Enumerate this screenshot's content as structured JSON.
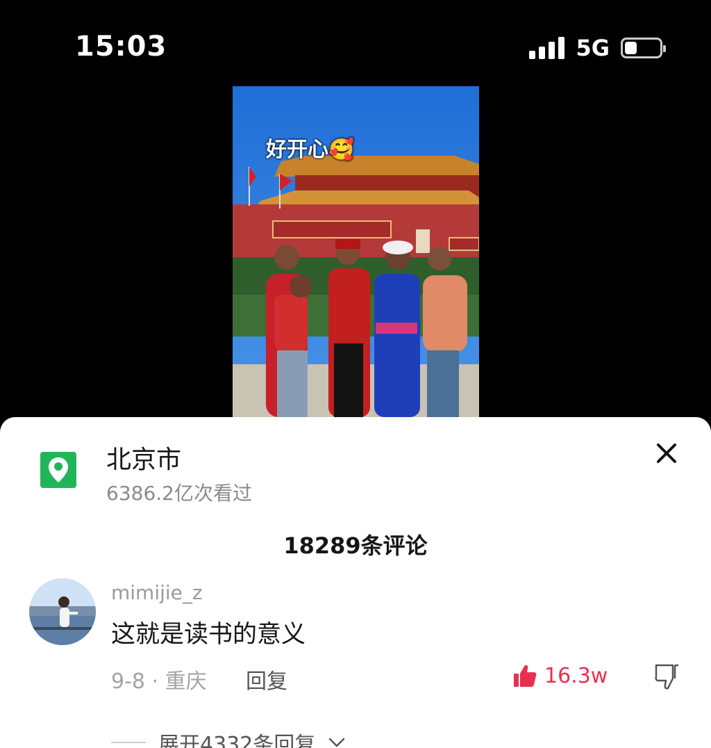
{
  "status_bar": {
    "time": "15:03",
    "network": "5G",
    "battery_level": 0.35
  },
  "video": {
    "caption": "好开心",
    "caption_emoji": "🥰"
  },
  "location": {
    "icon": "location-pin-icon",
    "title": "北京市",
    "views": "6386.2亿次看过"
  },
  "comments_header": {
    "count_label": "18289条评论"
  },
  "comment": {
    "username": "mimijie_z",
    "text": "这就是读书的意义",
    "date_location": "9-8 · 重庆",
    "reply_label": "回复",
    "like_count": "16.3w",
    "expand_label": "展开4332条回复"
  },
  "colors": {
    "accent_like": "#e8304e",
    "location_green": "#21b55a"
  }
}
